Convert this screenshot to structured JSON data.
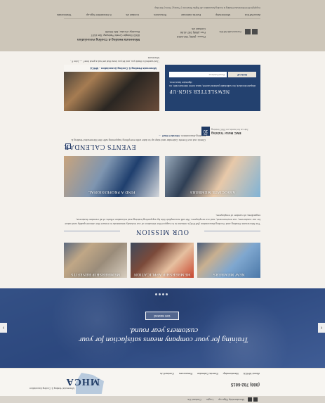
{
  "topbar": {
    "links": [
      "Membership Sign-up",
      "Login",
      "Contact Us"
    ]
  },
  "header": {
    "logo_text": "MHCA",
    "org_name": "Minnesota Heating & Cooling Association",
    "phone": "(888) 782-6815",
    "nav": [
      "About MHCA",
      "Membership",
      "Events Calendar",
      "Resources",
      "Contact Us"
    ]
  },
  "hero": {
    "title": "Training for your company means satisfaction for your customers year round.",
    "button": "Get Started",
    "prev": "‹",
    "next": "›"
  },
  "features": {
    "cards": [
      {
        "label": "MEMBERSHIP BENEFITS"
      },
      {
        "label": "MEMBERSHIP APPLICATION"
      },
      {
        "label": "NEW MEMBERS"
      }
    ]
  },
  "mission": {
    "title": "OUR MISSION",
    "text": "The Minnesota Heating and Cooling Association (MHCA)'s mission is to support the elevation of our industry standards to ensure the utmost quality and value for our customers, our environment, and our employees. We will accomplish this by supporting training and education efforts of all member business, regardless of number of employees."
  },
  "promo": {
    "cards": [
      {
        "label": "FIND A PROFESSIONAL"
      },
      {
        "label": "ASSOCIATE MEMBERS"
      }
    ]
  },
  "events": {
    "title": "EVENTS CALENDAR",
    "text": "Check out our Events Calendar and stay up to date with everything happening with the Minnesota Heating & Cooling Association.",
    "link": "Check it Out! →",
    "item": {
      "month": "Jan",
      "day": "10",
      "name": "EMC Motor Training",
      "location": "Join us for hands-on EMC training"
    }
  },
  "video": {
    "bar_title": "Minnesota Heating & Cooling Association - MHCA",
    "caption": "\"Just wanted to thank you, and let you know that we had a great time!\" — John F., Minnesota"
  },
  "newsletter": {
    "title": "NEWSLETTER SIGN-UP",
    "text": "Aliquam tincidunt, leo sollicitudin pulvinar laoreet, lacus lorem interdum nibh, eu dignissim lacus eros.",
    "input_placeholder": "Email Address",
    "button": "SIGN UP"
  },
  "footer": {
    "org_name": "Minnesota Heating & Cooling Association",
    "address_1": "8300 Shingle Creek Parkway, Ste #107",
    "address_2": "Brooklyn Center, MN 55430",
    "phone": "Phone: (888) 782-6815",
    "fax": "Fax: (888) 287-4156",
    "contact": "Contact Us",
    "connect": "Connect with MHCA",
    "nav": [
      "About MHCA",
      "Membership",
      "Events Calendar",
      "Resources",
      "Contact Us",
      "E-Newsletter Sign-up",
      "Testimonials"
    ],
    "copyright": "Copyright 2015 Minnesota Heating & Cooling Association. All Rights Reserved.  |  Privacy  |  Terms  |  Site Map"
  }
}
